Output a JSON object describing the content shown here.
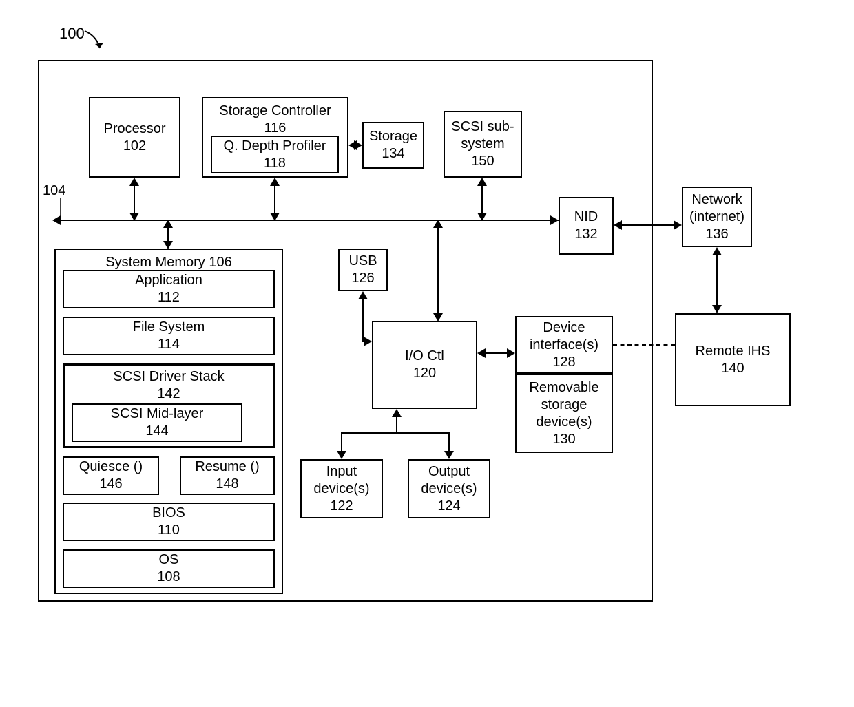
{
  "figure_number": "100",
  "bus_label": "104",
  "main_container": {
    "id": "main-enclosure"
  },
  "blocks": {
    "processor": {
      "label": "Processor",
      "num": "102"
    },
    "storage_controller": {
      "label": "Storage Controller",
      "num": "116"
    },
    "q_depth_profiler": {
      "label": "Q. Depth Profiler",
      "num": "118"
    },
    "storage": {
      "label": "Storage",
      "num": "134"
    },
    "scsi_subsystem": {
      "label": "SCSI sub-system",
      "num": "150"
    },
    "nid": {
      "label": "NID",
      "num": "132"
    },
    "network": {
      "label": "Network (internet)",
      "num": "136"
    },
    "remote_ihs": {
      "label": "Remote IHS",
      "num": "140"
    },
    "system_memory": {
      "label": "System Memory 106"
    },
    "application": {
      "label": "Application",
      "num": "112"
    },
    "file_system": {
      "label": "File System",
      "num": "114"
    },
    "scsi_driver_stack": {
      "label": "SCSI Driver Stack",
      "num": "142"
    },
    "scsi_mid_layer": {
      "label": "SCSI Mid-layer",
      "num": "144"
    },
    "quiesce": {
      "label": "Quiesce ()",
      "num": "146"
    },
    "resume": {
      "label": "Resume ()",
      "num": "148"
    },
    "bios": {
      "label": "BIOS",
      "num": "110"
    },
    "os": {
      "label": "OS",
      "num": "108"
    },
    "usb": {
      "label": "USB",
      "num": "126"
    },
    "io_ctl": {
      "label": "I/O Ctl",
      "num": "120"
    },
    "input_devices": {
      "label": "Input device(s)",
      "num": "122"
    },
    "output_devices": {
      "label": "Output device(s)",
      "num": "124"
    },
    "device_interfaces": {
      "label": "Device interface(s)",
      "num": "128"
    },
    "removable_storage": {
      "label": "Removable storage device(s)",
      "num": "130"
    }
  }
}
